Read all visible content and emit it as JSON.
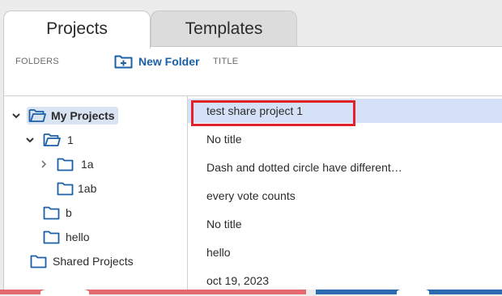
{
  "tabs": [
    {
      "label": "Projects",
      "active": true
    },
    {
      "label": "Templates",
      "active": false
    }
  ],
  "header": {
    "folders_label": "FOLDERS",
    "new_folder_label": "New Folder",
    "title_label": "TITLE"
  },
  "tree": {
    "my_projects": "My Projects",
    "f1": "1",
    "f1a": "1a",
    "f1ab": "1ab",
    "fb": "b",
    "fhello": "hello",
    "shared": "Shared Projects"
  },
  "projects": [
    {
      "title": "test share project 1",
      "selected": true
    },
    {
      "title": "No title"
    },
    {
      "title": "Dash and dotted circle have different…"
    },
    {
      "title": "every vote counts"
    },
    {
      "title": "No title"
    },
    {
      "title": "hello"
    },
    {
      "title": "oct 19, 2023"
    }
  ],
  "colors": {
    "accent": "#1b5fa7",
    "selected_row": "#d4e1f7",
    "highlight": "#e1222a",
    "folder_stroke": "#1b5fa7"
  }
}
